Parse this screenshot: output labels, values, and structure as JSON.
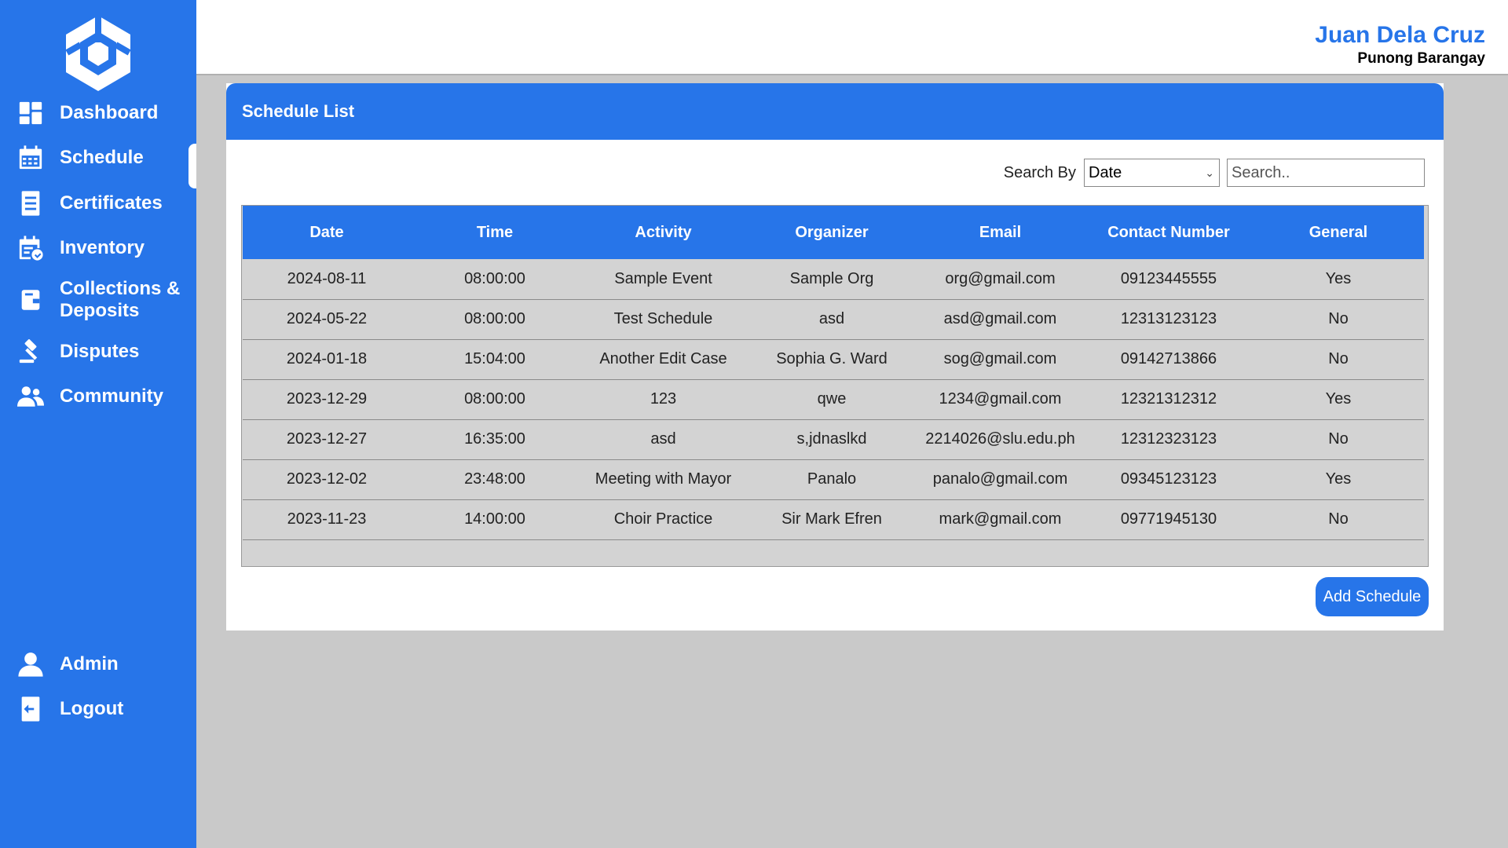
{
  "app": {
    "user_name": "Juan Dela Cruz",
    "user_role": "Punong Barangay"
  },
  "sidebar": {
    "items": [
      {
        "label": "Dashboard",
        "icon": "dashboard-icon"
      },
      {
        "label": "Schedule",
        "icon": "calendar-icon",
        "active": true
      },
      {
        "label": "Certificates",
        "icon": "document-icon"
      },
      {
        "label": "Inventory",
        "icon": "inventory-icon"
      },
      {
        "label": "Collections &\nDeposits",
        "icon": "wallet-icon"
      },
      {
        "label": "Disputes",
        "icon": "gavel-icon"
      },
      {
        "label": "Community",
        "icon": "people-icon"
      }
    ],
    "bottom_items": [
      {
        "label": "Admin",
        "icon": "user-icon"
      },
      {
        "label": "Logout",
        "icon": "logout-icon"
      }
    ]
  },
  "main": {
    "card_title": "Schedule List",
    "search": {
      "label": "Search By",
      "selected": "Date",
      "placeholder": "Search.."
    },
    "table": {
      "headers": [
        "Date",
        "Time",
        "Activity",
        "Organizer",
        "Email",
        "Contact Number",
        "General"
      ],
      "rows": [
        [
          "2024-08-11",
          "08:00:00",
          "Sample Event",
          "Sample Org",
          "org@gmail.com",
          "09123445555",
          "Yes"
        ],
        [
          "2024-05-22",
          "08:00:00",
          "Test Schedule",
          "asd",
          "asd@gmail.com",
          "12313123123",
          "No"
        ],
        [
          "2024-01-18",
          "15:04:00",
          "Another Edit Case",
          "Sophia G. Ward",
          "sog@gmail.com",
          "09142713866",
          "No"
        ],
        [
          "2023-12-29",
          "08:00:00",
          "123",
          "qwe",
          "1234@gmail.com",
          "12321312312",
          "Yes"
        ],
        [
          "2023-12-27",
          "16:35:00",
          "asd",
          "s,jdnaslkd",
          "2214026@slu.edu.ph",
          "12312323123",
          "No"
        ],
        [
          "2023-12-02",
          "23:48:00",
          "Meeting with Mayor",
          "Panalo",
          "panalo@gmail.com",
          "09345123123",
          "Yes"
        ],
        [
          "2023-11-23",
          "14:00:00",
          "Choir Practice",
          "Sir Mark Efren",
          "mark@gmail.com",
          "09771945130",
          "No"
        ]
      ]
    },
    "add_button": "Add Schedule"
  },
  "colors": {
    "brand": "#2775e9",
    "background": "#c9c9c9",
    "row": "#d3d3d3"
  }
}
